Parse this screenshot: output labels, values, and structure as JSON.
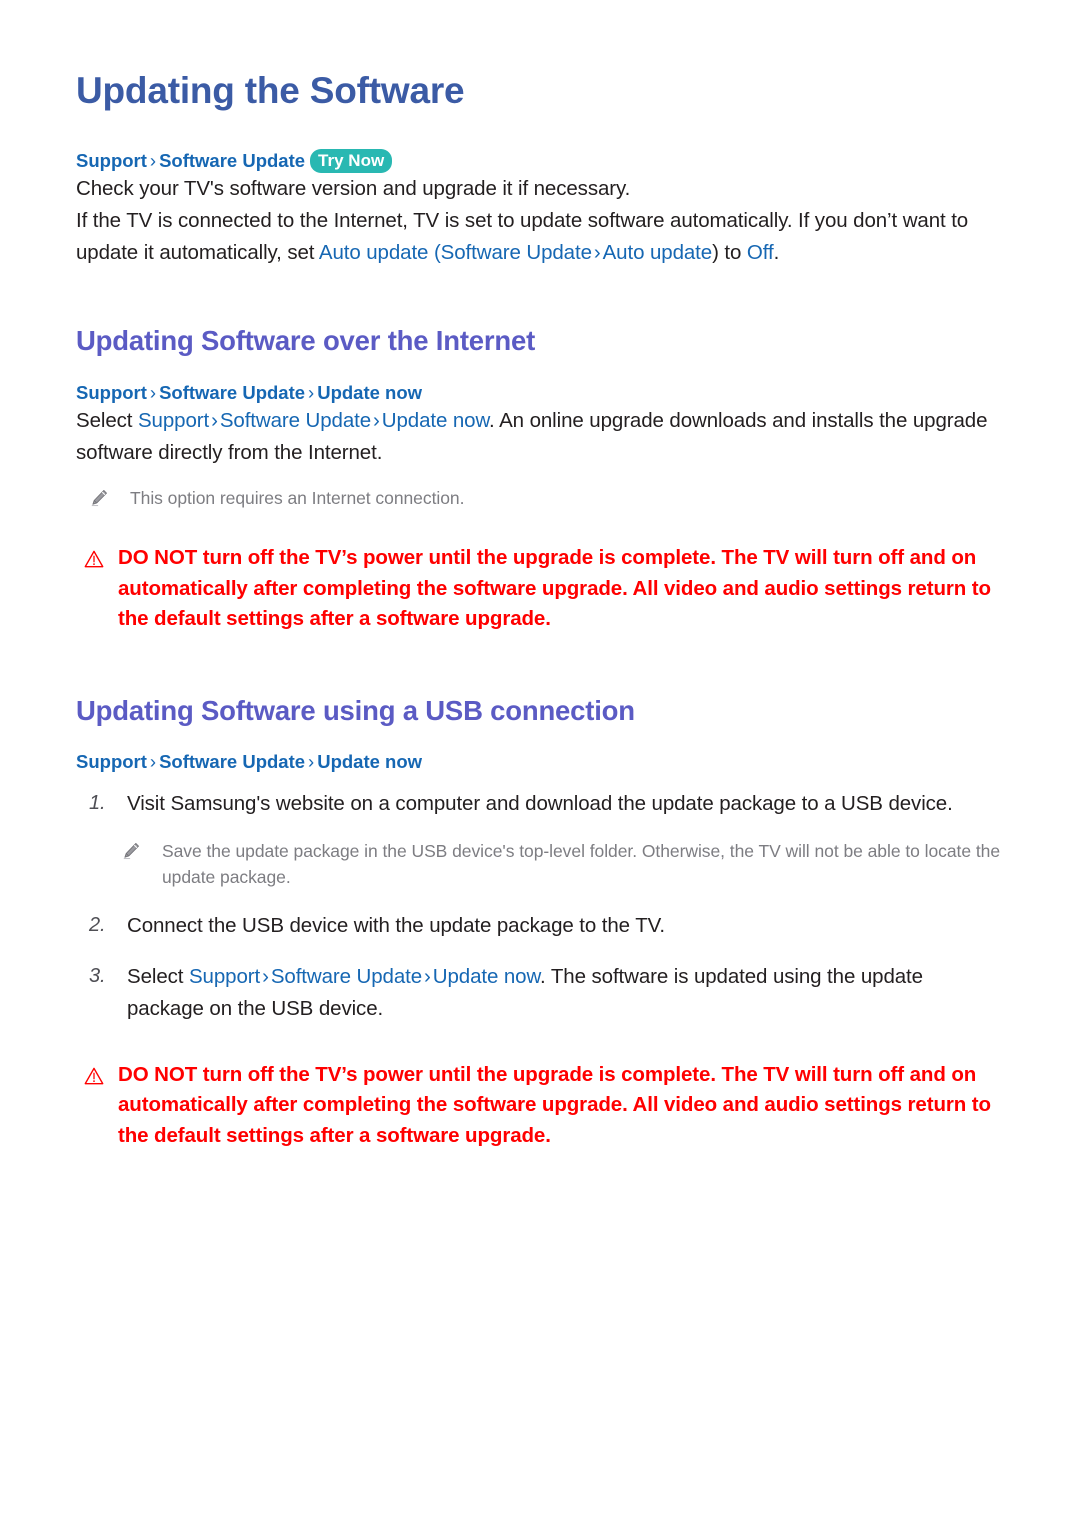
{
  "document": {
    "title": "Updating the Software"
  },
  "intro": {
    "breadcrumb": {
      "item1": "Support",
      "separator": "›",
      "item2": "Software Update",
      "badge": "Try Now"
    },
    "paragraph_check": "Check your TV's software version and upgrade it if necessary.",
    "paragraph_auto": {
      "part1": "If the TV is connected to the Internet, TV is set to update software automatically. If you don’t want to update it automatically, set ",
      "kw1": "Auto update",
      "part2": " (",
      "kw2": "Software Update",
      "sep": "›",
      "kw3": "Auto update",
      "part3": ") to ",
      "kw4": "Off",
      "part4": "."
    }
  },
  "section_internet": {
    "heading": "Updating Software over the Internet",
    "breadcrumb": {
      "item1": "Support",
      "separator": "›",
      "item2": "Software Update",
      "item3": "Update now"
    },
    "paragraph_select": {
      "part1": "Select ",
      "kw1": "Support",
      "sep1": "›",
      "kw2": "Software Update",
      "sep2": "›",
      "kw3": "Update now",
      "part2": ". An online upgrade downloads and installs the upgrade software directly from the Internet."
    },
    "note": {
      "icon": "pencil-icon",
      "text": "This option requires an Internet connection."
    },
    "warning": {
      "icon": "warning-triangle-icon",
      "text": "DO NOT turn off the TV’s power until the upgrade is complete. The TV will turn off and on automatically after completing the software upgrade. All video and audio settings return to the default settings after a software upgrade."
    }
  },
  "section_usb": {
    "heading": "Updating Software using a USB connection",
    "breadcrumb": {
      "item1": "Support",
      "separator": "›",
      "item2": "Software Update",
      "item3": "Update now"
    },
    "steps": [
      {
        "number": "1.",
        "text": "Visit Samsung's website on a computer and download the update package to a USB device."
      },
      {
        "number": "2.",
        "text": "Connect the USB device with the update package to the TV."
      },
      {
        "number": "3.",
        "part1": "Select ",
        "kw1": "Support",
        "sep1": "›",
        "kw2": "Software Update",
        "sep2": "›",
        "kw3": "Update now",
        "part2": ". The software is updated using the update package on the USB device."
      }
    ],
    "note": {
      "icon": "pencil-icon",
      "text": "Save the update package in the USB device's top-level folder. Otherwise, the TV will not be able to locate the update package."
    },
    "warning": {
      "icon": "warning-triangle-icon",
      "text": "DO NOT turn off the TV’s power until the upgrade is complete. The TV will turn off and on automatically after completing the software upgrade. All video and audio settings return to the default settings after a software upgrade."
    }
  },
  "colors": {
    "title_blue": "#3b5ba5",
    "heading_purple": "#5b5bc4",
    "link_blue": "#1667b3",
    "badge_teal": "#29b8b2",
    "warning_red": "#ff0000",
    "note_gray": "#7d7d82",
    "body_text": "#231f20"
  }
}
